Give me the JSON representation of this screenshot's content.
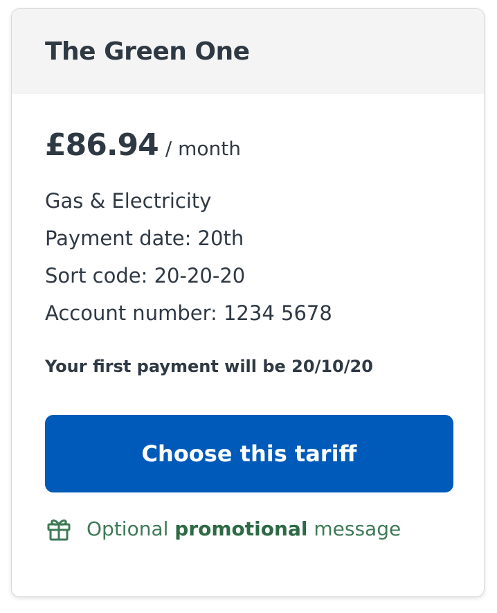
{
  "card": {
    "title": "The Green One",
    "price": "£86.94",
    "price_unit": "/ month",
    "details": [
      "Gas & Electricity",
      "Payment date: 20th",
      "Sort code: 20-20-20",
      "Account number: 1234 5678"
    ],
    "first_payment": "Your first payment will be 20/10/20",
    "cta_label": "Choose this tariff",
    "promo": {
      "icon": "gift-icon",
      "prefix": "Optional",
      "emphasis": "promotional",
      "suffix": "message"
    }
  },
  "colors": {
    "header_bg": "#f4f4f4",
    "text": "#2f3944",
    "button": "#005ab9",
    "promo": "#3d7a55"
  }
}
